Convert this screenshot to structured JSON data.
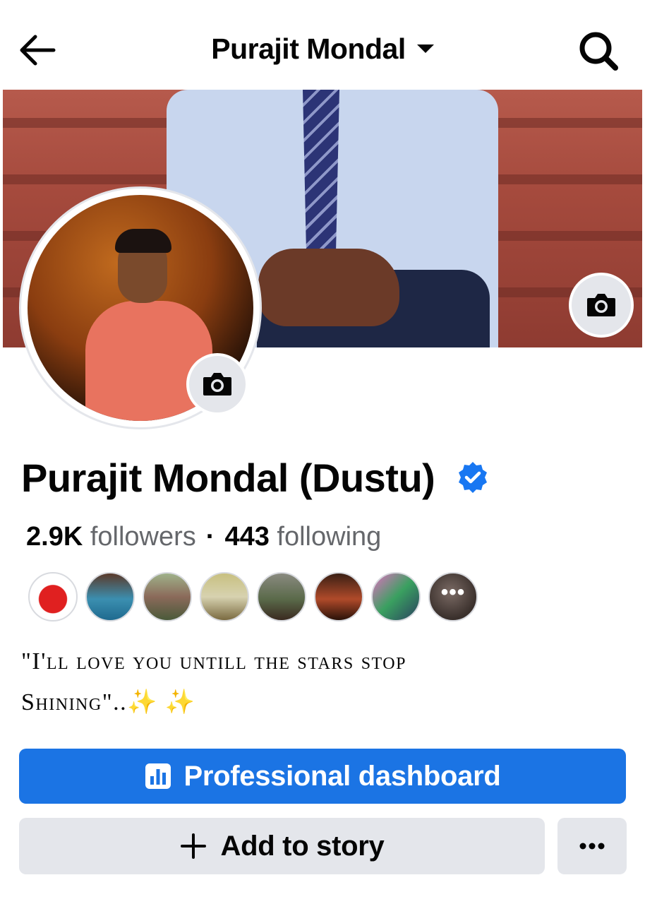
{
  "header": {
    "title": "Purajit Mondal",
    "back_icon": "arrow-left-icon",
    "search_icon": "search-icon",
    "dropdown_icon": "caret-down-icon"
  },
  "profile": {
    "name": "Purajit Mondal (Dustu)",
    "verified_icon": "verified-badge-icon",
    "followers_count": "2.9K",
    "followers_label": "followers",
    "separator": "·",
    "following_count": "443",
    "following_label": "following"
  },
  "friends": {
    "more_label": "•••"
  },
  "bio": {
    "line1": "\"I'll love you untill the stars stop",
    "line2": "Shining\"..✨ ✨"
  },
  "actions": {
    "professional_dashboard": "Professional dashboard",
    "add_to_story": "Add to story",
    "more": "•••"
  },
  "colors": {
    "primary": "#1b74e4",
    "verified": "#1877f2",
    "secondary_button": "#e4e6eb",
    "muted_text": "#65676b",
    "text": "#050505"
  }
}
